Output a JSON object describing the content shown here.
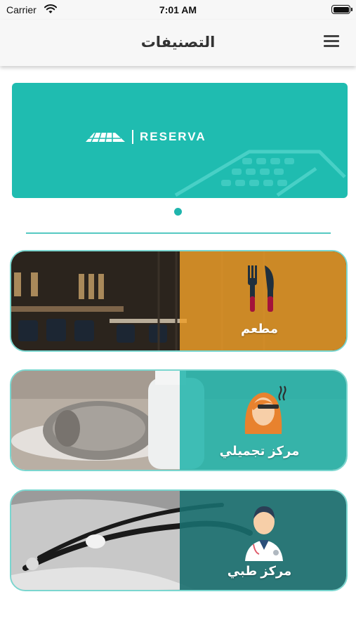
{
  "status_bar": {
    "carrier": "Carrier",
    "time": "7:01 AM",
    "wifi_icon": "wifi-icon",
    "battery_icon": "battery-icon"
  },
  "nav": {
    "title": "التصنيفات",
    "menu_icon": "hamburger-menu-icon"
  },
  "banner": {
    "logo_text": "RESERVA",
    "color": "#1fbcb0",
    "page_count": 1,
    "active_page": 1
  },
  "categories": [
    {
      "label": "مطعم",
      "icon": "fork-knife-icon",
      "color": "#f0a028"
    },
    {
      "label": "مركز تجميلي",
      "icon": "beauty-woman-icon",
      "color": "#1eb4aa"
    },
    {
      "label": "مركز طبي",
      "icon": "doctor-icon",
      "color": "#186e6e"
    }
  ],
  "colors": {
    "accent": "#1fb5ad",
    "nav_background": "#f7f7f7"
  }
}
